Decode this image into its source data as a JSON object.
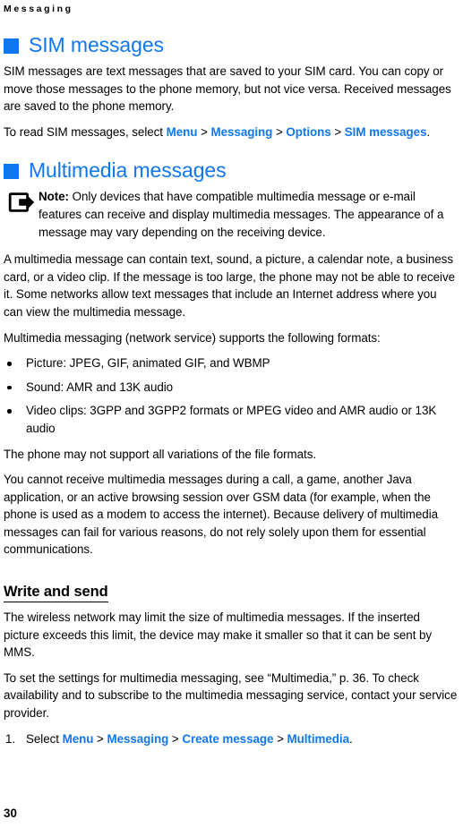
{
  "running_head": "Messaging",
  "colors": {
    "link_blue": "#1177ee",
    "heading_blue": "#1177ee",
    "text_black": "#000000",
    "page_background": "#ffffff"
  },
  "sections": [
    {
      "bullet_icon": "blue-square-bullet",
      "heading": "SIM messages",
      "paragraphs": [
        "SIM messages are text messages that are saved to your SIM card. You can copy or move those messages to the phone memory, but not vice versa. Received messages are saved to the phone memory."
      ],
      "nav_sentence": {
        "prefix": "To read SIM messages, select ",
        "path": [
          "Menu",
          "Messaging",
          "Options",
          "SIM messages"
        ],
        "separator": " > ",
        "suffix": "."
      }
    },
    {
      "bullet_icon": "blue-square-bullet",
      "heading": "Multimedia messages"
    }
  ],
  "note": {
    "icon": "note-arrow-icon",
    "label": "Note:",
    "text": " Only devices that have compatible multimedia message or e-mail features can receive and display multimedia messages. The appearance of a message may vary depending on the receiving device."
  },
  "body": {
    "p_contains": "A multimedia message can contain text, sound, a picture, a calendar note, a business card, or a video clip. If the message is too large, the phone may not be able to receive it. Some networks allow text messages that include an Internet address where you can view the multimedia message.",
    "p_formats_intro": "Multimedia messaging (network service) supports the following formats:",
    "format_items": [
      "Picture: JPEG, GIF, animated GIF, and WBMP",
      "Sound: AMR and 13K audio",
      "Video clips: 3GPP and 3GPP2 formats or MPEG video and AMR audio or 13K audio"
    ],
    "p_variations": "The phone may not support all variations of the file formats.",
    "p_cannot_receive": "You cannot receive multimedia messages during a call, a game, another Java application, or an active browsing session over GSM data (for example, when the phone is used as a modem to access the internet). Because delivery of multimedia messages can fail for various reasons, do not rely solely upon them for essential communications."
  },
  "write_and_send": {
    "heading": "Write and send",
    "p_limit": "The wireless network may limit the size of multimedia messages. If the inserted picture exceeds this limit, the device may make it smaller so that it can be sent by MMS.",
    "p_settings": "To set the settings for multimedia messaging, see “Multimedia,” p. 36. To check availability and to subscribe to the multimedia messaging service, contact your service provider.",
    "step_1": {
      "number": "1.",
      "prefix": "Select ",
      "path": [
        "Menu",
        "Messaging",
        "Create message",
        "Multimedia"
      ],
      "separator": " > ",
      "suffix": "."
    }
  },
  "page_number": "30"
}
